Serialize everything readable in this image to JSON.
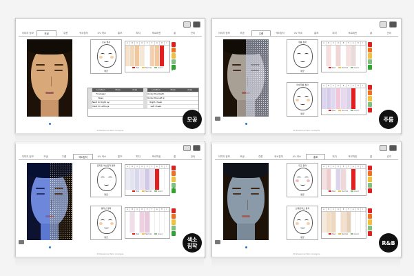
{
  "tabs": [
    "이미지 정보",
    "모공",
    "주름",
    "색소침착",
    "UV 색소",
    "홍조",
    "피지",
    "포르피린",
    "결",
    "관리"
  ],
  "panels": [
    {
      "badge": "모공",
      "active_tab": 1,
      "diagram_top_title": "모공 결과",
      "diagram_top_label": "평균",
      "footer": "Professional Skin Analysis",
      "table": {
        "headers": [
          "Location",
          "Pixel",
          "Area",
          "Location",
          "Pixel",
          "Area"
        ],
        "rows": [
          [
            "Forehead",
            "",
            "",
            "Under the Right eye",
            "",
            ""
          ],
          [
            "Nose",
            "",
            "",
            "Under the Left eye",
            "",
            ""
          ],
          [
            "Next to Right eye",
            "",
            "",
            "Right cheek",
            "",
            ""
          ],
          [
            "Next to Left eye",
            "",
            "",
            "Left cheek",
            "",
            ""
          ]
        ]
      },
      "legend": [
        "Bad",
        "Normal",
        "Good"
      ]
    },
    {
      "badge": "주름",
      "active_tab": 2,
      "diagram_top_title": "주름 결과",
      "diagram_top_label": "평균",
      "diagram_bottom_title": "미세주름 결과",
      "diagram_bottom_label": "평균",
      "footer": "Professional Skin Analysis",
      "legend": [
        "Bad",
        "Normal",
        "Good"
      ]
    },
    {
      "badge": "색소\n침착",
      "active_tab": 3,
      "diagram_top_title": "표피층 색소침착 결과",
      "diagram_top_label": "평균",
      "diagram_bottom_title": "멜라닌 결과",
      "diagram_bottom_label": "평균",
      "footer": "Professional Skin Analysis",
      "legend": [
        "Bad",
        "Normal",
        "Good"
      ]
    },
    {
      "badge": "R&B",
      "active_tab": 5,
      "diagram_top_title": "홍조 결과",
      "diagram_top_label": "평균",
      "diagram_bottom_title": "브레운색소 결과",
      "diagram_bottom_label": "평균",
      "footer": "Professional Skin Analysis",
      "legend": [
        "Bad",
        "Normal",
        "Good"
      ]
    }
  ],
  "bar_headers": [
    "A",
    "B",
    "C",
    "D",
    "E",
    "F",
    "G",
    "H",
    "I"
  ],
  "colors": {
    "bad": "#e02020",
    "normal": "#f0c040",
    "good": "#80c080",
    "accent_blue": "#2a6fd0"
  }
}
